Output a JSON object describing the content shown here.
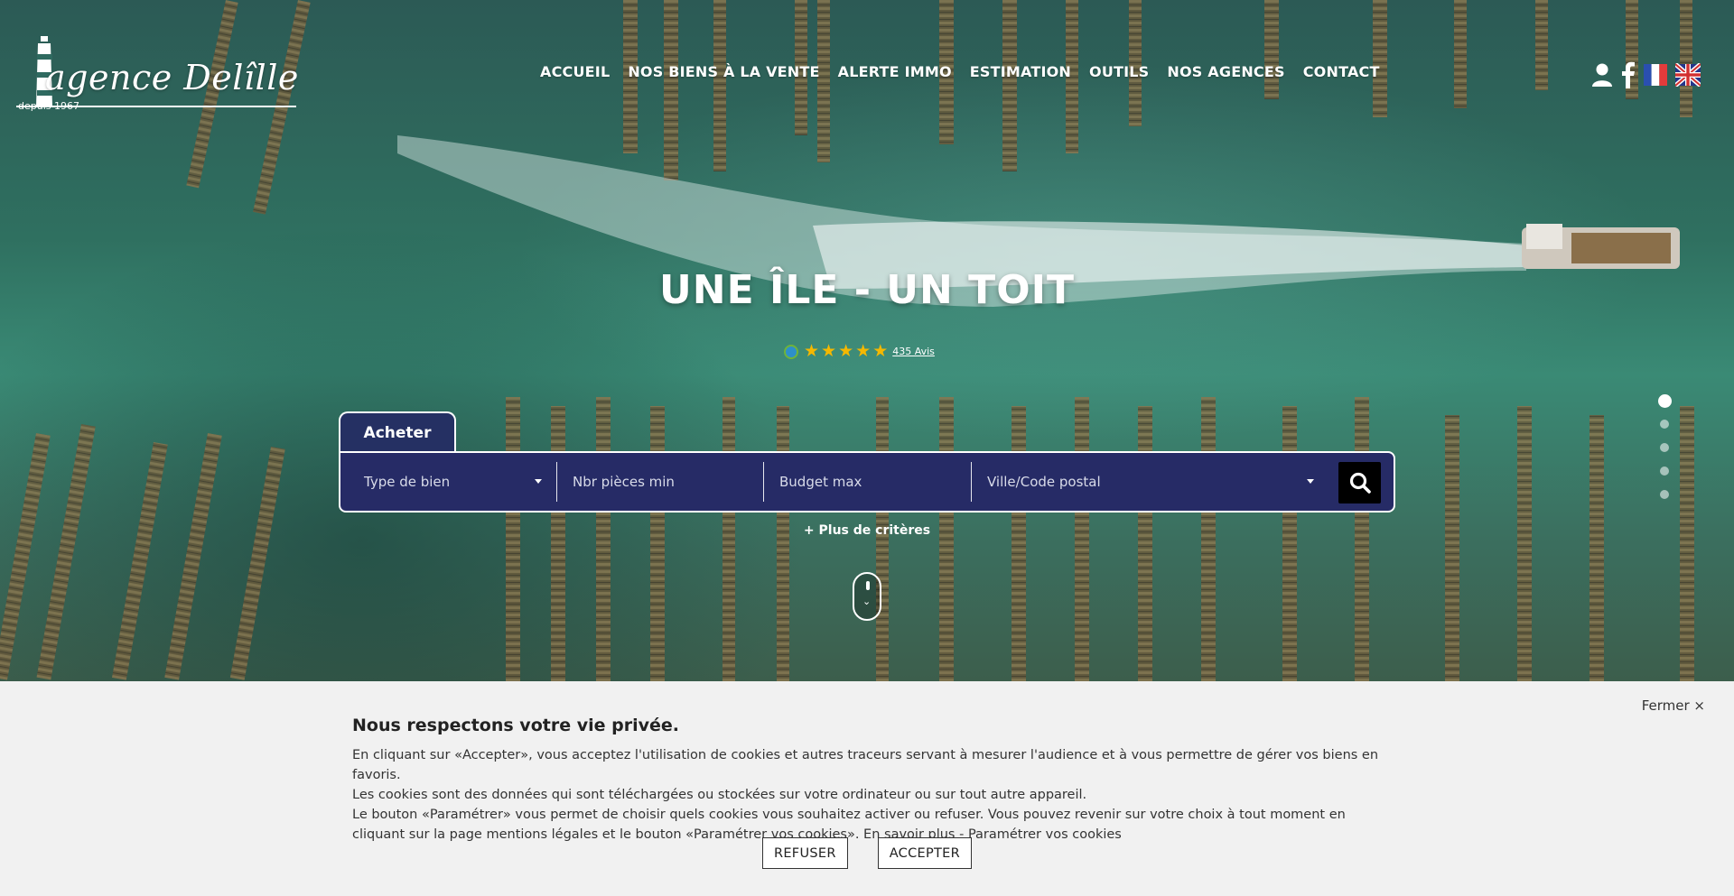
{
  "header": {
    "logo": {
      "name": "agence Delîlle",
      "tagline": "depuis 1967"
    },
    "nav": [
      {
        "label": "ACCUEIL"
      },
      {
        "label": "NOS BIENS À LA VENTE"
      },
      {
        "label": "ALERTE IMMO"
      },
      {
        "label": "ESTIMATION"
      },
      {
        "label": "OUTILS"
      },
      {
        "label": "NOS AGENCES"
      },
      {
        "label": "CONTACT"
      }
    ],
    "icons": [
      "user-icon",
      "facebook-icon",
      "flag-fr-icon",
      "flag-uk-icon"
    ]
  },
  "hero": {
    "title": "UNE ÎLE - UN TOIT",
    "reviews": {
      "stars": 5,
      "count_label": "435 Avis"
    }
  },
  "search": {
    "tab_label": "Acheter",
    "fields": {
      "type": "Type de bien",
      "rooms": "Nbr pièces min",
      "budget": "Budget max",
      "city": "Ville/Code postal"
    },
    "more_criteria": "+ Plus de critères"
  },
  "carousel": {
    "count": 5,
    "active_index": 0
  },
  "cookie": {
    "close_label": "Fermer ×",
    "title": "Nous respectons votre vie privée.",
    "line1": "En cliquant sur «Accepter», vous acceptez l'utilisation de cookies et autres traceurs servant à mesurer l'audience et à vous permettre de gérer vos biens en favoris.",
    "line2": "Les cookies sont des données qui sont téléchargées ou stockées sur votre ordinateur ou sur tout autre appareil.",
    "line3": "Le bouton «Paramétrer» vous permet de choisir quels cookies vous souhaitez activer ou refuser. Vous pouvez revenir sur votre choix à tout moment en cliquant sur la page mentions légales et le bouton «Paramétrer vos cookies». En savoir plus - Paramétrer vos cookies",
    "refuse_label": "REFUSER",
    "accept_label": "ACCEPTER"
  },
  "colors": {
    "search_bg": "#262b66",
    "star": "#f5b800",
    "cookie_bg": "#f1f1f1"
  }
}
